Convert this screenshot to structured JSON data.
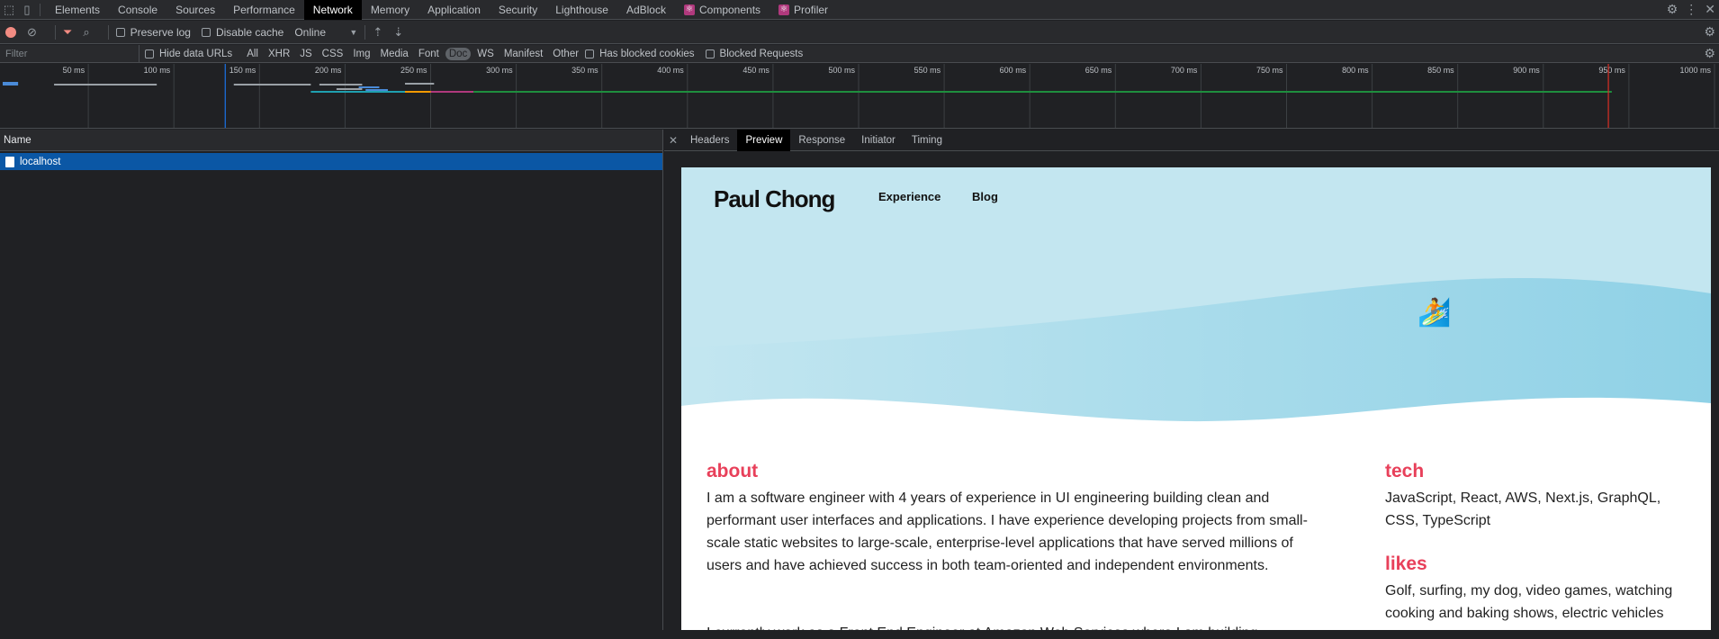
{
  "tabs": [
    {
      "label": "Elements"
    },
    {
      "label": "Console"
    },
    {
      "label": "Sources"
    },
    {
      "label": "Performance"
    },
    {
      "label": "Network",
      "active": true
    },
    {
      "label": "Memory"
    },
    {
      "label": "Application"
    },
    {
      "label": "Security"
    },
    {
      "label": "Lighthouse"
    },
    {
      "label": "AdBlock"
    },
    {
      "label": "Components",
      "react": true
    },
    {
      "label": "Profiler",
      "react": true
    }
  ],
  "toolbar": {
    "preserve_log": "Preserve log",
    "disable_cache": "Disable cache",
    "throttle": "Online"
  },
  "filterbar": {
    "placeholder": "Filter",
    "hide_data_urls": "Hide data URLs",
    "types": [
      "All",
      "XHR",
      "JS",
      "CSS",
      "Img",
      "Media",
      "Font",
      "Doc",
      "WS",
      "Manifest",
      "Other"
    ],
    "active_type": "Doc",
    "has_blocked_cookies": "Has blocked cookies",
    "blocked_requests": "Blocked Requests"
  },
  "timeline": {
    "ticks": [
      "50 ms",
      "100 ms",
      "150 ms",
      "200 ms",
      "250 ms",
      "300 ms",
      "350 ms",
      "400 ms",
      "450 ms",
      "500 ms",
      "550 ms",
      "600 ms",
      "650 ms",
      "700 ms",
      "750 ms",
      "800 ms",
      "850 ms",
      "900 ms",
      "950 ms",
      "1000 ms"
    ],
    "dom_content_loaded_ms": 130,
    "load_ms": 938
  },
  "requests": {
    "column": "Name",
    "rows": [
      {
        "name": "localhost"
      }
    ]
  },
  "details": {
    "tabs": [
      "Headers",
      "Preview",
      "Response",
      "Initiator",
      "Timing"
    ],
    "active": "Preview"
  },
  "preview": {
    "logo": "Paul Chong",
    "nav": [
      "Experience",
      "Blog"
    ],
    "surfer": "🏄",
    "about_title": "about",
    "about_lines": [
      "I am a software engineer with 4 years of experience in UI engineering building clean and",
      "performant user interfaces and applications. I have experience developing projects from small-",
      "scale static websites to large-scale, enterprise-level applications that have served millions of",
      "users and have achieved success in both team-oriented and independent environments."
    ],
    "about_line2": "I currently work as a Front End Engineer at Amazon Web Services where I am building",
    "tech_title": "tech",
    "tech_lines": [
      "JavaScript, React, AWS, Next.js, GraphQL,",
      "CSS, TypeScript"
    ],
    "likes_title": "likes",
    "likes_lines": [
      "Golf, surfing, my dog, video games, watching",
      "cooking and baking shows, electric vehicles"
    ]
  },
  "colors": {
    "accent": "#e8405a",
    "hero_light": "#c3e6f0",
    "hero_dark": "#8fd1e6",
    "selected_row": "#0b57a5"
  }
}
